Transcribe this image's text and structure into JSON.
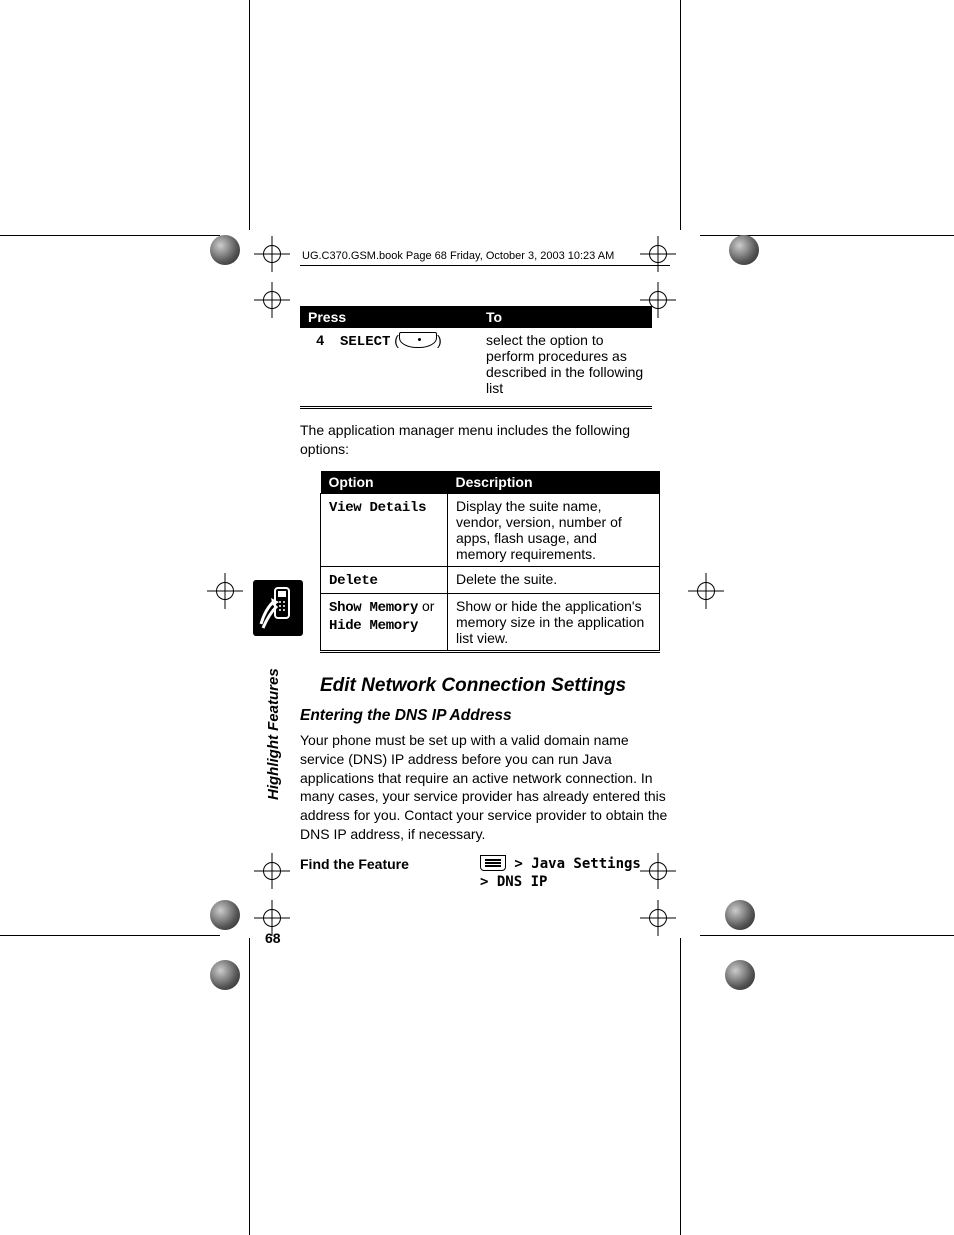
{
  "running_head": "UG.C370.GSM.book  Page 68  Friday, October 3, 2003  10:23 AM",
  "press_table": {
    "headers": {
      "press": "Press",
      "to": "To"
    },
    "row": {
      "step_num": "4",
      "press_label": "SELECT",
      "to_text": "select the option to perform procedures as described in the following list"
    }
  },
  "intro_paragraph": "The application manager menu includes the following options:",
  "options_table": {
    "headers": {
      "option": "Option",
      "description": "Description"
    },
    "rows": [
      {
        "option": "View Details",
        "option_suffix": "",
        "description": "Display the suite name, vendor, version, number of apps, flash usage, and memory requirements."
      },
      {
        "option": "Delete",
        "option_suffix": "",
        "description": "Delete the suite."
      },
      {
        "option": "Show Memory",
        "option_suffix": " or ",
        "option2": "Hide Memory",
        "description": "Show or hide the application's memory size in the application list view."
      }
    ]
  },
  "heading_section": "Edit Network Connection Settings",
  "heading_sub": "Entering the DNS IP Address",
  "dns_paragraph": "Your phone must be set up with a valid domain name service (DNS) IP address before you can run Java applications that require an active network connection. In many cases, your service provider has already entered this address for you. Contact your service provider to obtain the DNS IP address, if necessary.",
  "find_feature": {
    "label": "Find the Feature",
    "path_line1": " > Java Settings",
    "path_line2": "> DNS IP"
  },
  "sidebar_label": "Highlight Features",
  "page_number": "68"
}
